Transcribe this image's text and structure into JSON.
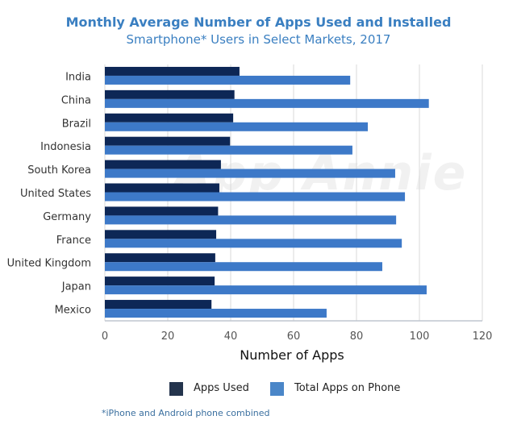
{
  "chart_data": {
    "type": "bar",
    "orientation": "horizontal",
    "title": "Monthly Average Number of Apps Used and Installed",
    "subtitle": "Smartphone* Users in Select Markets, 2017",
    "xlabel": "Number of Apps",
    "ylabel": "",
    "xlim": [
      0,
      120
    ],
    "xticks": [
      0,
      20,
      40,
      60,
      80,
      100,
      120
    ],
    "grid": true,
    "legend_position": "bottom",
    "categories": [
      "India",
      "China",
      "Brazil",
      "Indonesia",
      "South Korea",
      "United States",
      "Germany",
      "France",
      "United Kingdom",
      "Japan",
      "Mexico"
    ],
    "series": [
      {
        "name": "Apps Used",
        "color": "#0d2756",
        "values": [
          42.8,
          41.2,
          40.8,
          39.8,
          36.9,
          36.4,
          36.0,
          35.4,
          35.1,
          34.9,
          33.9
        ]
      },
      {
        "name": "Total Apps on Phone",
        "color": "#3d79c8",
        "values": [
          78.0,
          103.0,
          83.6,
          78.7,
          92.3,
          95.4,
          92.6,
          94.4,
          88.2,
          102.3,
          70.5
        ]
      }
    ],
    "footnote": "*iPhone and Android phone combined",
    "watermark": "App Annie"
  },
  "legend": {
    "used_label": "Apps Used",
    "total_label": "Total Apps on Phone",
    "used_color": "#24344d",
    "total_color": "#4a86c8"
  }
}
